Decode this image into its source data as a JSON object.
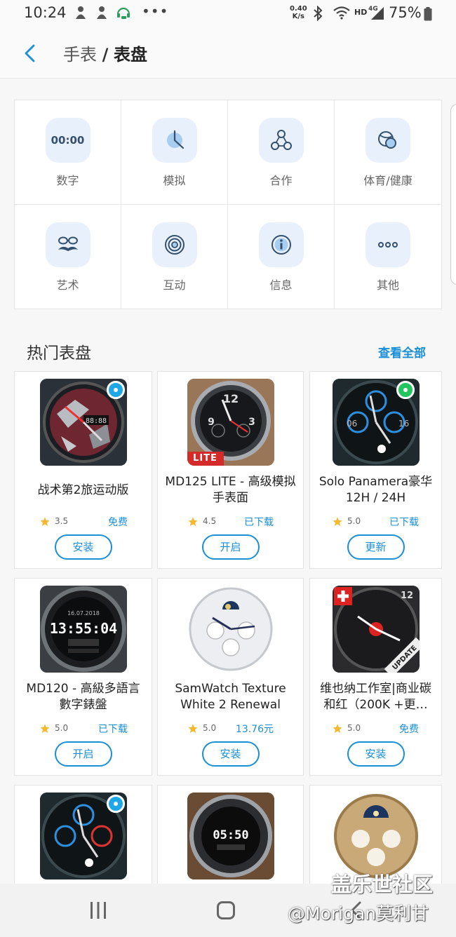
{
  "status_bar": {
    "time": "10:24",
    "net_speed_value": "0.40",
    "net_speed_unit": "K/s",
    "hd": "HD",
    "network": "4G",
    "battery": "75%"
  },
  "header": {
    "parent": "手表",
    "separator": "/",
    "current": "表盘"
  },
  "categories": [
    {
      "label": "数字",
      "icon": "digital-clock-icon",
      "glyph": "00:00"
    },
    {
      "label": "模拟",
      "icon": "analog-clock-icon"
    },
    {
      "label": "合作",
      "icon": "collaboration-icon"
    },
    {
      "label": "体育/健康",
      "icon": "sports-health-icon"
    },
    {
      "label": "艺术",
      "icon": "art-mustache-icon"
    },
    {
      "label": "互动",
      "icon": "interactive-rings-icon"
    },
    {
      "label": "信息",
      "icon": "info-icon"
    },
    {
      "label": "其他",
      "icon": "more-dots-icon"
    }
  ],
  "popular": {
    "title": "热门表盘",
    "see_all": "查看全部",
    "items": [
      {
        "name": "战术第2旅运动版",
        "rating": "3.5",
        "price": "免费",
        "button": "安装"
      },
      {
        "name": "MD125 LITE - 高级模拟手表面",
        "rating": "4.5",
        "price": "已下载",
        "button": "开启",
        "tag": "LITE"
      },
      {
        "name": "Solo Panamera豪华 12H / 24H",
        "rating": "5.0",
        "price": "已下载",
        "button": "更新"
      },
      {
        "name": "MD120 - 高級多語言數字錶盤",
        "rating": "5.0",
        "price": "已下载",
        "button": "开启",
        "face_text": "13:55:04"
      },
      {
        "name": "SamWatch Texture White 2 Renewal",
        "rating": "5.0",
        "price": "13.76元",
        "button": "安装"
      },
      {
        "name": "维也纳工作室|商业碳和红（200K +更…",
        "rating": "5.0",
        "price": "免费",
        "button": "安装",
        "face_text": "UPDATE"
      },
      {
        "name": "",
        "rating": "",
        "price": "",
        "button": ""
      },
      {
        "name": "",
        "rating": "",
        "price": "",
        "button": "",
        "face_text": "05:50"
      },
      {
        "name": "",
        "rating": "",
        "price": "",
        "button": ""
      }
    ]
  },
  "watermark": {
    "line1": "盖乐世社区",
    "line2": "@Morigan莫利甘"
  },
  "colors": {
    "accent": "#1a8fd6",
    "icon_bg": "#e8f1fb",
    "star": "#f5b82e",
    "badge_blue": "#1fa8e8",
    "badge_green": "#22c55e"
  }
}
